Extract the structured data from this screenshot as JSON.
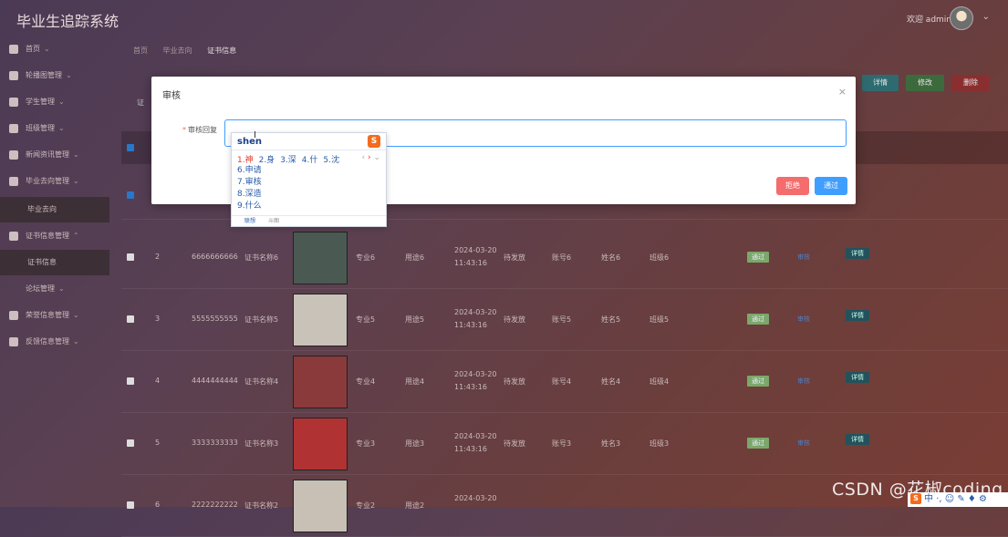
{
  "app": {
    "title": "毕业生追踪系统",
    "welcome": "欢迎 admin"
  },
  "sidebar": {
    "items": [
      {
        "label": "首页",
        "icon": "home-icon"
      },
      {
        "label": "轮播图管理",
        "icon": "grid-icon"
      },
      {
        "label": "学生管理",
        "icon": "user-icon"
      },
      {
        "label": "班级管理",
        "icon": "briefcase-icon"
      },
      {
        "label": "新闻资讯管理",
        "icon": "document-icon"
      },
      {
        "label": "毕业去向管理",
        "icon": "car-icon"
      },
      {
        "label": "毕业去向",
        "sub": true
      },
      {
        "label": "证书信息管理",
        "icon": "certificate-icon"
      },
      {
        "label": "证书信息",
        "sub": true
      },
      {
        "label": "论坛管理"
      },
      {
        "label": "荣誉信息管理",
        "icon": "honor-icon"
      },
      {
        "label": "反馈信息管理",
        "icon": "feedback-icon"
      }
    ]
  },
  "breadcrumb": {
    "items": [
      "首页",
      "毕业去向",
      "证书信息"
    ]
  },
  "toolbar": {
    "detail": "详情",
    "edit": "修改",
    "delete": "删除"
  },
  "filter": {
    "label": "证"
  },
  "modal": {
    "title": "审核",
    "field_label": "审核回复",
    "reject": "拒绝",
    "approve": "通过"
  },
  "ime": {
    "input": "shen",
    "candidates": [
      "1.神",
      "2.身",
      "3.深",
      "4.什",
      "5.沈"
    ],
    "more": [
      "6.申请",
      "7.审核",
      "8.深造",
      "9.什么"
    ],
    "footer": [
      "联想",
      "斗图"
    ]
  },
  "table": {
    "rows": [
      {
        "idx": "2",
        "cert_no": "6666666666",
        "cert_name": "证书名称6",
        "major": "专业6",
        "use": "用途6",
        "date": "2024-03-20",
        "time": "11:43:16",
        "status_text": "待发放",
        "account": "账号6",
        "name": "姓名6",
        "class": "班级6",
        "review": "通过",
        "review_link": "审核",
        "detail": "详情",
        "thumb_color": "#4a5a52"
      },
      {
        "idx": "3",
        "cert_no": "5555555555",
        "cert_name": "证书名称5",
        "major": "专业5",
        "use": "用途5",
        "date": "2024-03-20",
        "time": "11:43:16",
        "status_text": "待发放",
        "account": "账号5",
        "name": "姓名5",
        "class": "班级5",
        "review": "通过",
        "review_link": "审核",
        "detail": "详情",
        "thumb_color": "#c9c2b8"
      },
      {
        "idx": "4",
        "cert_no": "4444444444",
        "cert_name": "证书名称4",
        "major": "专业4",
        "use": "用途4",
        "date": "2024-03-20",
        "time": "11:43:16",
        "status_text": "待发放",
        "account": "账号4",
        "name": "姓名4",
        "class": "班级4",
        "review": "通过",
        "review_link": "审核",
        "detail": "详情",
        "thumb_color": "#8a3a3a"
      },
      {
        "idx": "5",
        "cert_no": "3333333333",
        "cert_name": "证书名称3",
        "major": "专业3",
        "use": "用途3",
        "date": "2024-03-20",
        "time": "11:43:16",
        "status_text": "待发放",
        "account": "账号3",
        "name": "姓名3",
        "class": "班级3",
        "review": "通过",
        "review_link": "审核",
        "detail": "详情",
        "thumb_color": "#b03232"
      },
      {
        "idx": "6",
        "cert_no": "2222222222",
        "cert_name": "证书名称2",
        "major": "专业2",
        "use": "用途2",
        "date": "2024-03-20",
        "time": "",
        "status_text": "",
        "account": "",
        "name": "",
        "class": "",
        "review": "",
        "review_link": "",
        "detail": "",
        "thumb_color": "#c8bfb5"
      }
    ]
  },
  "watermark": "CSDN @花椒coding",
  "tray": {
    "text": "中 ·, ☺ ✎ ♦ ⚙"
  }
}
